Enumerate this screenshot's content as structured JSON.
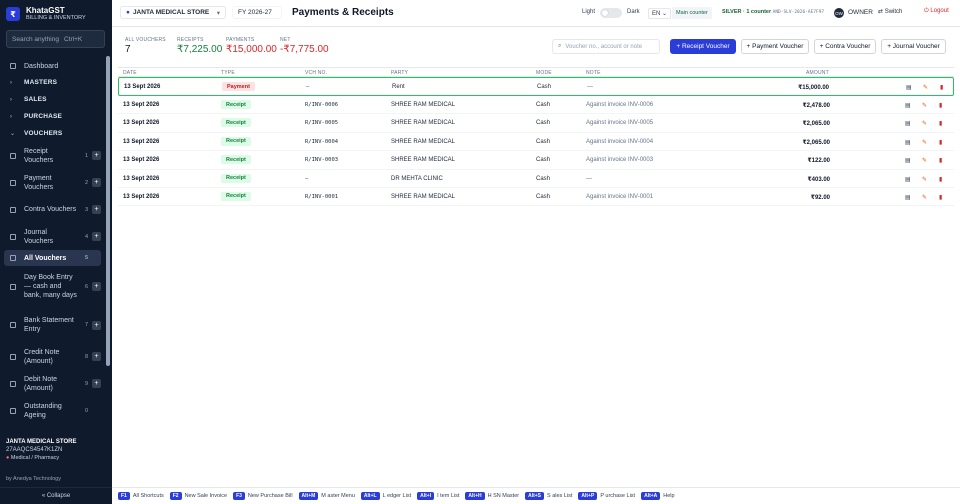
{
  "app": {
    "name": "KhataGST",
    "subtitle": "BILLING & INVENTORY",
    "logo_glyph": "₹"
  },
  "search": {
    "placeholder": "Search anything",
    "shortcut": "Ctrl+K"
  },
  "sidebar": {
    "items": [
      {
        "label": "Dashboard",
        "icon": "dashboard-icon"
      },
      {
        "label": "MASTERS",
        "group": true,
        "chev": "›"
      },
      {
        "label": "SALES",
        "group": true,
        "chev": "›"
      },
      {
        "label": "PURCHASE",
        "group": true,
        "chev": "›"
      },
      {
        "label": "VOUCHERS",
        "group": true,
        "chev": "⌄"
      },
      {
        "label": "Receipt Vouchers",
        "num": "1",
        "plus": "+"
      },
      {
        "label": "Payment Vouchers",
        "num": "2",
        "plus": "+"
      },
      {
        "label": "Contra Vouchers",
        "num": "3",
        "plus": "+"
      },
      {
        "label": "Journal Vouchers",
        "num": "4",
        "plus": "+"
      },
      {
        "label": "All Vouchers",
        "num": "5",
        "active": true
      },
      {
        "label": "Day Book Entry — cash and bank, many days",
        "num": "6",
        "plus": "+"
      },
      {
        "label": "Bank Statement Entry",
        "num": "7",
        "plus": "+"
      },
      {
        "label": "Credit Note (Amount)",
        "num": "8",
        "plus": "+"
      },
      {
        "label": "Debit Note (Amount)",
        "num": "9",
        "plus": "+"
      },
      {
        "label": "Outstanding Ageing",
        "num": "0"
      }
    ],
    "store_name": "JANTA MEDICAL STORE",
    "gstin": "27AAQCS4547K1ZN",
    "store_type": "Medical / Pharmacy",
    "by": "by Anedya Technology",
    "collapse": "« Collapse"
  },
  "topbar": {
    "store_selector": "JANTA MEDICAL STORE",
    "fy": "FY 2026-27",
    "title": "Payments & Receipts",
    "light": "Light",
    "dark": "Dark",
    "lang": "EN",
    "counter": "Main counter",
    "plan": "SILVER · 1 counter",
    "plan_id": "AND-SLV-2026-AE7F97",
    "avatar": "OW",
    "role": "OWNER",
    "switch": "Switch",
    "logout": "Logout"
  },
  "summary": {
    "all_label": "ALL VOUCHERS",
    "all_value": "7",
    "receipts_label": "RECEIPTS",
    "receipts_value": "₹7,225.00",
    "payments_label": "PAYMENTS",
    "payments_value": "₹15,000.00",
    "net_label": "NET",
    "net_value": "-₹7,775.00"
  },
  "actions": {
    "search_placeholder": "Voucher no., account or note",
    "receipt": "+ Receipt Voucher",
    "payment": "+ Payment Voucher",
    "contra": "+ Contra Voucher",
    "journal": "+ Journal Voucher"
  },
  "table": {
    "headers": {
      "date": "DATE",
      "type": "TYPE",
      "vch": "VCH NO.",
      "party": "PARTY",
      "mode": "MODE",
      "note": "NOTE",
      "amount": "AMOUNT"
    },
    "rows": [
      {
        "date": "13 Sept 2026",
        "type": "Payment",
        "vch": "—",
        "party": "Rent",
        "mode": "Cash",
        "note": "—",
        "amount": "₹15,000.00"
      },
      {
        "date": "13 Sept 2026",
        "type": "Receipt",
        "vch": "R/INV-0006",
        "party": "SHREE RAM MEDICAL",
        "mode": "Cash",
        "note": "Against invoice INV-0006",
        "amount": "₹2,478.00"
      },
      {
        "date": "13 Sept 2026",
        "type": "Receipt",
        "vch": "R/INV-0005",
        "party": "SHREE RAM MEDICAL",
        "mode": "Cash",
        "note": "Against invoice INV-0005",
        "amount": "₹2,065.00"
      },
      {
        "date": "13 Sept 2026",
        "type": "Receipt",
        "vch": "R/INV-0004",
        "party": "SHREE RAM MEDICAL",
        "mode": "Cash",
        "note": "Against invoice INV-0004",
        "amount": "₹2,065.00"
      },
      {
        "date": "13 Sept 2026",
        "type": "Receipt",
        "vch": "R/INV-0003",
        "party": "SHREE RAM MEDICAL",
        "mode": "Cash",
        "note": "Against invoice INV-0003",
        "amount": "₹122.00"
      },
      {
        "date": "13 Sept 2026",
        "type": "Receipt",
        "vch": "—",
        "party": "DR MEHTA CLINIC",
        "mode": "Cash",
        "note": "—",
        "amount": "₹403.00"
      },
      {
        "date": "13 Sept 2026",
        "type": "Receipt",
        "vch": "R/INV-0001",
        "party": "SHREE RAM MEDICAL",
        "mode": "Cash",
        "note": "Against invoice INV-0001",
        "amount": "₹92.00"
      }
    ]
  },
  "shortcuts": [
    {
      "key": "F1",
      "label": "All Shortcuts"
    },
    {
      "key": "F2",
      "label": "New Sale Invoice"
    },
    {
      "key": "F3",
      "label": "New Purchase Bill"
    },
    {
      "key": "Alt+M",
      "label": "M aster Menu"
    },
    {
      "key": "Alt+L",
      "label": "L edger List"
    },
    {
      "key": "Alt+I",
      "label": "I tem List"
    },
    {
      "key": "Alt+H",
      "label": "H SN Master"
    },
    {
      "key": "Alt+S",
      "label": "S ales List"
    },
    {
      "key": "Alt+P",
      "label": "P urchase List"
    },
    {
      "key": "Alt+A",
      "label": "Help"
    }
  ],
  "colors": {
    "accent": "#2a3dd8",
    "sidebar_bg": "#0f1b2d",
    "payment": "#b91c1c",
    "receipt": "#15803d",
    "net": "#dc2626"
  }
}
